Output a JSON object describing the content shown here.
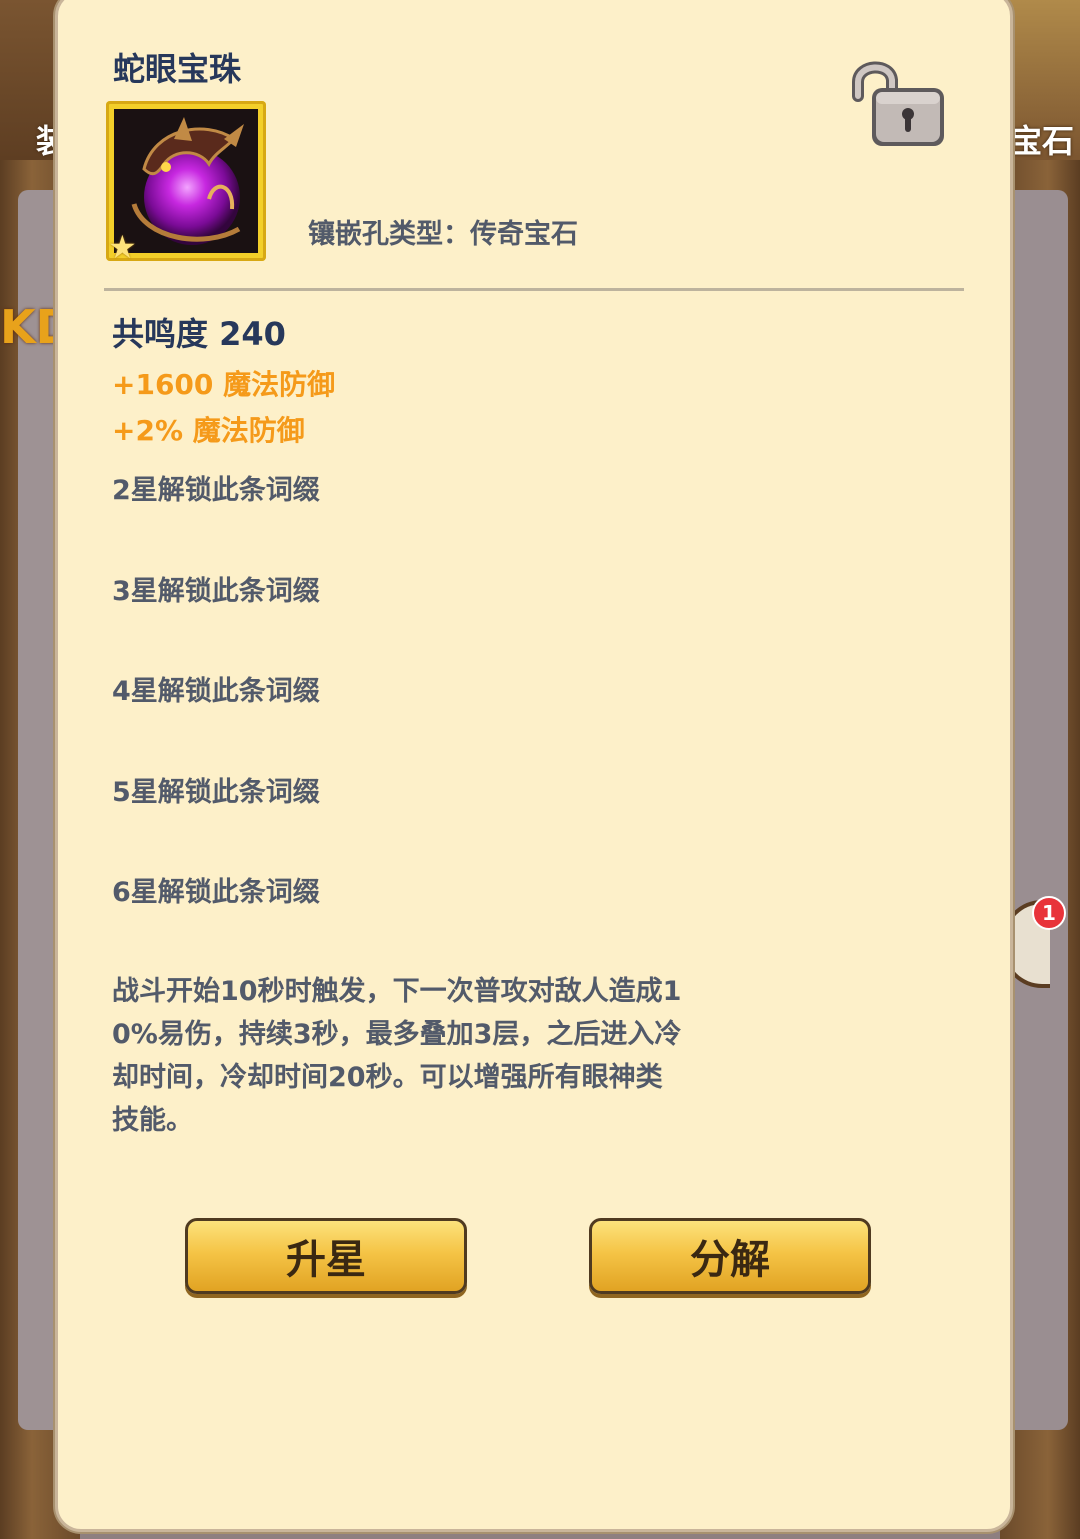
{
  "background": {
    "left_tab_label": "装",
    "right_tab_label": "宝石",
    "left_partial_text": "KD",
    "right_badge_count": "1"
  },
  "item": {
    "name": "蛇眼宝珠",
    "star_count": 1,
    "icon": "snake-eye-orb-icon",
    "lock_state": "unlocked",
    "socket_type_label": "镶嵌孔类型：传奇宝石"
  },
  "stats": {
    "resonance": "共鸣度 240",
    "bonuses": [
      "+1600 魔法防御",
      "+2% 魔法防御"
    ],
    "locked_affixes": [
      "2星解锁此条词缀",
      "3星解锁此条词缀",
      "4星解锁此条词缀",
      "5星解锁此条词缀",
      "6星解锁此条词缀"
    ]
  },
  "description": "战斗开始10秒时触发，下一次普攻对敌人造成1\n0%易伤，持续3秒，最多叠加3层，之后进入冷\n却时间，冷却时间20秒。可以增强所有眼神类\n技能。",
  "actions": {
    "upgrade_label": "升星",
    "decompose_label": "分解"
  },
  "colors": {
    "panel_bg": "#fdf0c9",
    "title": "#27385b",
    "bonus": "#f59a1a",
    "muted_text": "#525a6a",
    "button_gold": "#f5c446"
  }
}
